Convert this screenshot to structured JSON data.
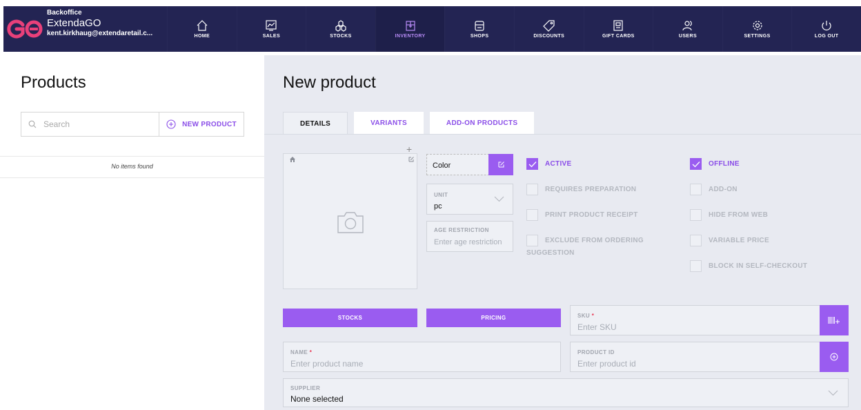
{
  "app": {
    "brand_sub": "Backoffice",
    "brand_name": "ExtendaGO",
    "user_email": "kent.kirkhaug@extendaretail.c..."
  },
  "nav": {
    "items": [
      {
        "label": "HOME",
        "icon": "home-icon"
      },
      {
        "label": "SALES",
        "icon": "sales-chart-icon"
      },
      {
        "label": "STOCKS",
        "icon": "stocks-boxes-icon"
      },
      {
        "label": "INVENTORY",
        "icon": "inventory-box-icon",
        "active": true
      },
      {
        "label": "SHOPS",
        "icon": "shop-icon"
      },
      {
        "label": "DISCOUNTS",
        "icon": "tag-icon"
      },
      {
        "label": "GIFT CARDS",
        "icon": "gift-card-icon"
      },
      {
        "label": "USERS",
        "icon": "users-icon"
      },
      {
        "label": "SETTINGS",
        "icon": "gear-icon"
      },
      {
        "label": "LOG OUT",
        "icon": "power-icon"
      }
    ]
  },
  "left": {
    "title": "Products",
    "search_placeholder": "Search",
    "new_product_label": "NEW PRODUCT",
    "empty_text": "No items found"
  },
  "main": {
    "title": "New product",
    "tabs": [
      {
        "label": "DETAILS",
        "active": true
      },
      {
        "label": "VARIANTS"
      },
      {
        "label": "ADD-ON PRODUCTS"
      }
    ],
    "color_label": "Color",
    "unit": {
      "label": "UNIT",
      "value": "pc"
    },
    "age": {
      "label": "AGE RESTRICTION",
      "placeholder": "Enter age restriction"
    },
    "checkboxes_left": [
      {
        "label": "ACTIVE",
        "checked": true
      },
      {
        "label": "REQUIRES PREPARATION",
        "checked": false
      },
      {
        "label": "PRINT PRODUCT RECEIPT",
        "checked": false
      },
      {
        "label": "EXCLUDE FROM ORDERING",
        "label2": "SUGGESTION",
        "checked": false
      }
    ],
    "checkboxes_right": [
      {
        "label": "OFFLINE",
        "checked": true
      },
      {
        "label": "ADD-ON",
        "checked": false
      },
      {
        "label": "HIDE FROM WEB",
        "checked": false
      },
      {
        "label": "VARIABLE PRICE",
        "checked": false
      },
      {
        "label": "BLOCK IN SELF-CHECKOUT",
        "checked": false
      }
    ],
    "stocks_button": "STOCKS",
    "pricing_button": "PRICING",
    "sku": {
      "label": "SKU",
      "required": "*",
      "placeholder": "Enter SKU"
    },
    "name": {
      "label": "NAME",
      "required": "*",
      "placeholder": "Enter product name"
    },
    "product_id": {
      "label": "PRODUCT ID",
      "placeholder": "Enter product id"
    },
    "supplier": {
      "label": "SUPPLIER",
      "value": "None selected"
    }
  },
  "colors": {
    "topbar": "#232453",
    "accent": "#9a5cf0",
    "accent_text": "#8a4de8",
    "panel": "#e8eaf1"
  }
}
